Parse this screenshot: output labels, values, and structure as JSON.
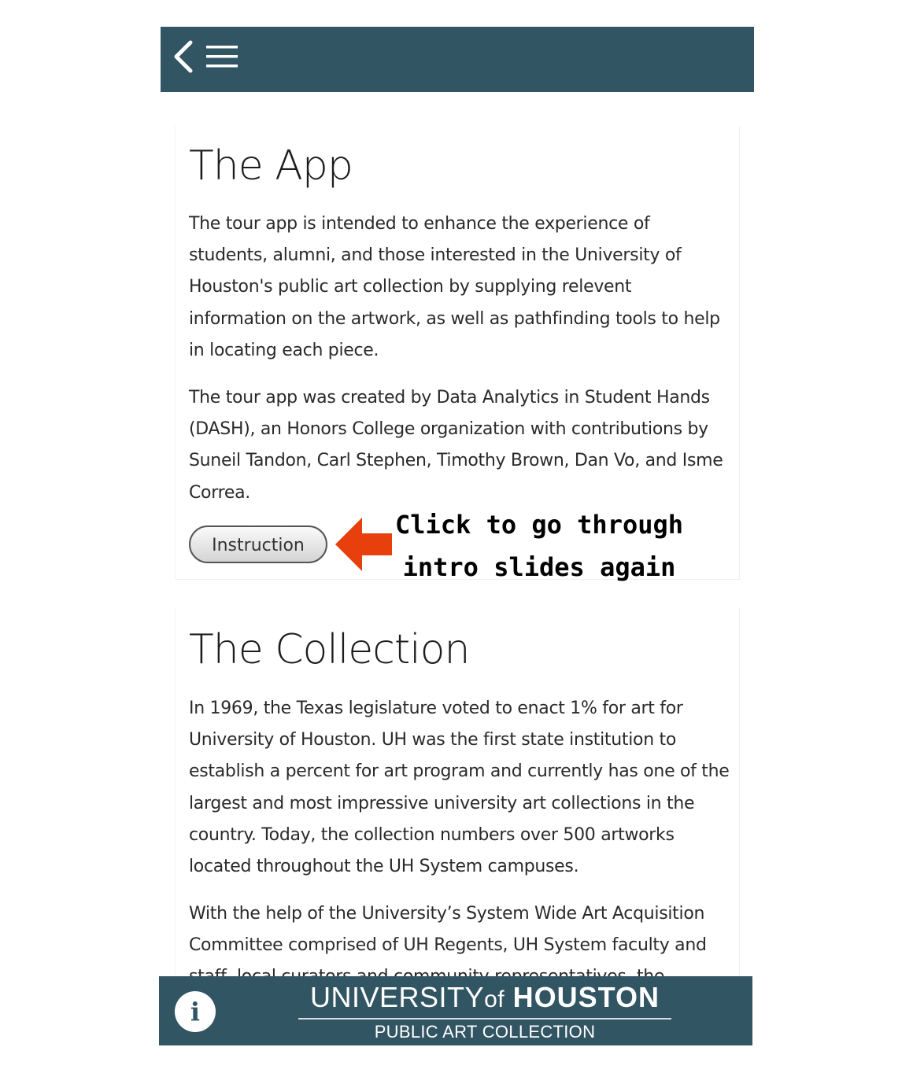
{
  "header": {
    "back_icon": "chevron-left-icon",
    "menu_icon": "hamburger-menu-icon"
  },
  "app_section": {
    "title": "The App",
    "paragraph1": "The tour app is intended to enhance the experience of students, alumni, and those interested in the University of Houston's public art collection by supplying relevent information on the artwork, as well as pathfinding tools to help in locating each piece.",
    "paragraph2": "The tour app was created by Data Analytics in Student Hands (DASH), an Honors College organization with contributions by Suneil Tandon, Carl Stephen, Timothy Brown, Dan Vo, and Isme Correa.",
    "instruction_button": "Instruction"
  },
  "annotation": {
    "line1": "Click to go through",
    "line2": "intro slides again",
    "arrow_color": "#e8400c"
  },
  "collection_section": {
    "title": "The Collection",
    "paragraph1": "In 1969, the Texas legislature voted to enact 1% for art for University of Houston. UH was the first state institution to establish a percent for art program and currently has one of the largest and most impressive university art collections in the country. Today, the collection numbers over 500 artworks located throughout the UH System campuses.",
    "paragraph2": "With the help of the University’s System Wide Art Acquisition Committee comprised of UH Regents, UH System faculty and staff, local curators and community representatives, the"
  },
  "footer": {
    "info_label": "i",
    "logo_university": "UNIVERSITY",
    "logo_of": "of",
    "logo_houston": "HOUSTON",
    "logo_subtitle": "PUBLIC ART COLLECTION"
  },
  "colors": {
    "bar_background": "#325563",
    "accent_arrow": "#e8400c"
  }
}
